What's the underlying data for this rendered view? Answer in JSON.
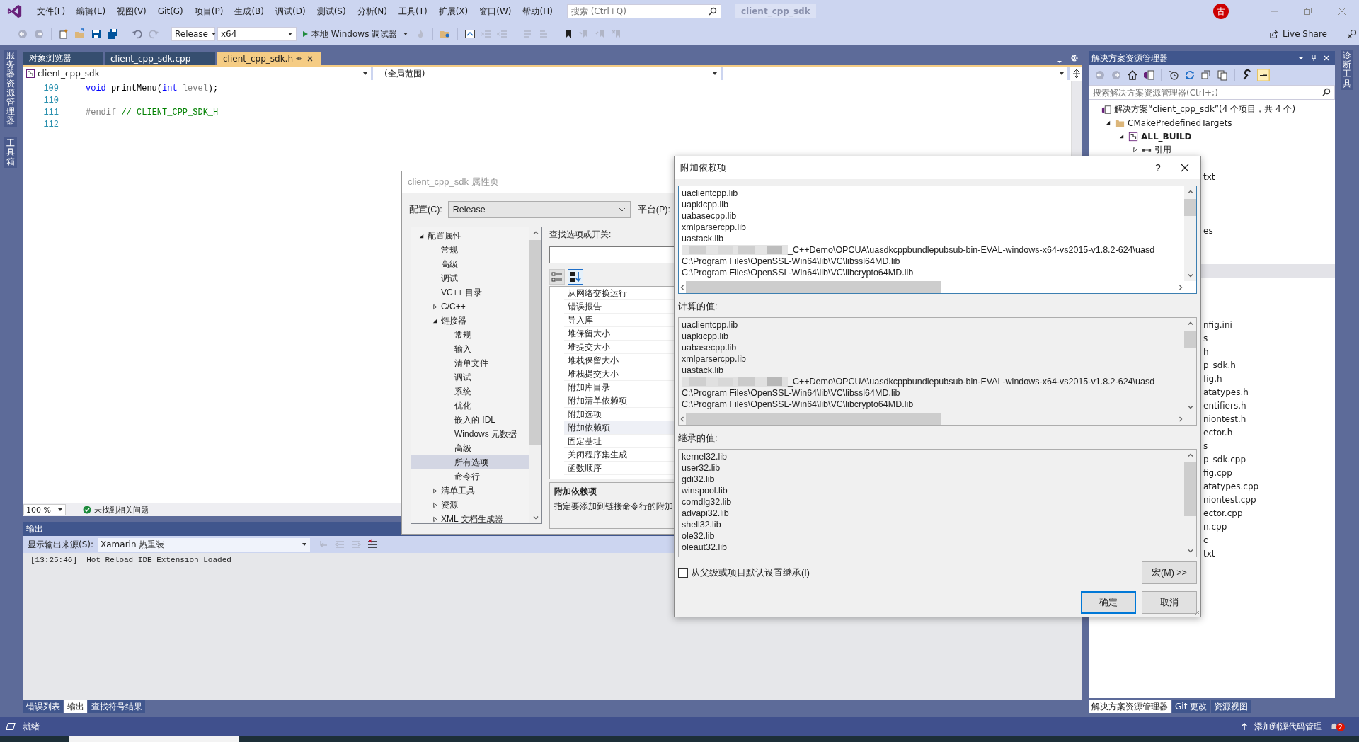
{
  "menu_bar": {
    "items": [
      "文件(F)",
      "编辑(E)",
      "视图(V)",
      "Git(G)",
      "项目(P)",
      "生成(B)",
      "调试(D)",
      "测试(S)",
      "分析(N)",
      "工具(T)",
      "扩展(X)",
      "窗口(W)",
      "帮助(H)"
    ],
    "search": {
      "placeholder": "搜索 (Ctrl+Q)"
    },
    "solution_name": "client_cpp_sdk",
    "avatar": "古"
  },
  "toolbar": {
    "configuration": "Release",
    "platform": "x64",
    "debugger": "本地 Windows 调试器",
    "live_share": "Live Share"
  },
  "left_rail": [
    "服务器资源管理器",
    "工具箱"
  ],
  "right_rail": [
    "诊断工具"
  ],
  "editor": {
    "tabs": [
      {
        "label": "对象浏览器",
        "selected": false
      },
      {
        "label": "client_cpp_sdk.cpp",
        "selected": false
      },
      {
        "label": "client_cpp_sdk.h",
        "selected": true
      }
    ],
    "project": "client_cpp_sdk",
    "scope": "(全局范围)",
    "lines": [
      {
        "number": "109",
        "tokens": [
          {
            "kind": "keyword",
            "text": "void"
          },
          {
            "kind": "plain",
            "text": " printMenu("
          },
          {
            "kind": "keyword",
            "text": "int"
          },
          {
            "kind": "param",
            "text": " level"
          },
          {
            "kind": "plain",
            "text": ");"
          }
        ]
      },
      {
        "number": "110"
      },
      {
        "number": "111",
        "tokens": [
          {
            "kind": "preprocessor",
            "text": "#endif"
          },
          {
            "kind": "comment",
            "text": " // CLIENT_CPP_SDK_H"
          }
        ]
      },
      {
        "number": "112"
      }
    ],
    "zoom": "100 %",
    "issues": "未找到相关问题"
  },
  "output": {
    "title": "输出",
    "source_label": "显示输出来源(S):",
    "source": "Xamarin 热重装",
    "lines": [
      "[13:25:46]  Hot Reload IDE Extension Loaded"
    ],
    "tabs": [
      {
        "label": "错误列表",
        "selected": false
      },
      {
        "label": "输出",
        "selected": true
      },
      {
        "label": "查找符号结果",
        "selected": false
      }
    ]
  },
  "solution_explorer": {
    "title": "解决方案资源管理器",
    "search": {
      "placeholder": "搜索解决方案资源管理器(Ctrl+;)"
    },
    "tree": [
      {
        "label": "解决方案“client_cpp_sdk”(4 个项目，共 4 个)",
        "kind": "solution",
        "children": [
          {
            "label": "CMakePredefinedTargets",
            "kind": "folder",
            "expanded": true,
            "children": [
              {
                "label": "ALL_BUILD",
                "kind": "project",
                "startup": true,
                "expanded": true,
                "children": [
                  {
                    "label": "引用",
                    "kind": "references",
                    "expanded": false
                  }
                ]
              }
            ]
          }
        ]
      }
    ],
    "covered_rows": [
      {
        "selected": false
      },
      {
        "text": "txt",
        "selected": false
      },
      {
        "selected": false
      },
      {
        "selected": false
      },
      {
        "selected": false
      },
      {
        "text": "es",
        "selected": false
      },
      {
        "selected": false
      },
      {
        "selected": false
      },
      {
        "selected": true
      },
      {
        "selected": false
      },
      {
        "selected": false
      },
      {
        "selected": false
      },
      {
        "text": "nfig.ini",
        "selected": false
      },
      {
        "text": "s",
        "selected": false
      },
      {
        "text": "h",
        "selected": false
      },
      {
        "text": "p_sdk.h",
        "selected": false
      },
      {
        "text": "fig.h",
        "selected": false
      },
      {
        "text": "atatypes.h",
        "selected": false
      },
      {
        "text": "entifiers.h",
        "selected": false
      },
      {
        "text": "niontest.h",
        "selected": false
      },
      {
        "text": "ector.h",
        "selected": false
      },
      {
        "text": "s",
        "selected": false
      },
      {
        "text": "p_sdk.cpp",
        "selected": false
      },
      {
        "text": "fig.cpp",
        "selected": false
      },
      {
        "text": "atatypes.cpp",
        "selected": false
      },
      {
        "text": "niontest.cpp",
        "selected": false
      },
      {
        "text": "ector.cpp",
        "selected": false
      },
      {
        "text": "n.cpp",
        "selected": false
      },
      {
        "text": "c",
        "selected": false
      },
      {
        "text": "txt",
        "selected": false
      }
    ],
    "tabs": [
      {
        "label": "解决方案资源管理器",
        "selected": true
      },
      {
        "label": "Git 更改",
        "selected": false
      },
      {
        "label": "资源视图",
        "selected": false
      }
    ]
  },
  "status_bar": {
    "text": "就绪",
    "source_control": "添加到源代码管理",
    "notifications": "2"
  },
  "property_pages": {
    "title": "client_cpp_sdk 属性页",
    "config_label": "配置(C):",
    "configuration": "Release",
    "platform_label": "平台(P):",
    "tree": [
      {
        "label": "配置属性",
        "expanded": true,
        "selected": false,
        "children": [
          {
            "label": "常规",
            "selected": false
          },
          {
            "label": "高级",
            "selected": false
          },
          {
            "label": "调试",
            "selected": false
          },
          {
            "label": "VC++ 目录",
            "selected": false
          },
          {
            "label": "C/C++",
            "expanded": false,
            "selected": false
          },
          {
            "label": "链接器",
            "expanded": true,
            "selected": false,
            "children": [
              {
                "label": "常规",
                "selected": false
              },
              {
                "label": "输入",
                "selected": false
              },
              {
                "label": "清单文件",
                "selected": false
              },
              {
                "label": "调试",
                "selected": false
              },
              {
                "label": "系统",
                "selected": false
              },
              {
                "label": "优化",
                "selected": false
              },
              {
                "label": "嵌入的 IDL",
                "selected": false
              },
              {
                "label": "Windows 元数据",
                "selected": false
              },
              {
                "label": "高级",
                "selected": false
              },
              {
                "label": "所有选项",
                "selected": true
              },
              {
                "label": "命令行",
                "selected": false
              }
            ]
          },
          {
            "label": "清单工具",
            "expanded": false,
            "selected": false
          },
          {
            "label": "资源",
            "expanded": false,
            "selected": false
          },
          {
            "label": "XML 文档生成器",
            "expanded": false,
            "selected": false
          }
        ]
      }
    ],
    "search_label": "查找选项或开关:",
    "properties": [
      {
        "name": "从网络交换运行",
        "selected": false
      },
      {
        "name": "错误报告",
        "selected": false
      },
      {
        "name": "导入库",
        "selected": false
      },
      {
        "name": "堆保留大小",
        "selected": false
      },
      {
        "name": "堆提交大小",
        "selected": false
      },
      {
        "name": "堆栈保留大小",
        "selected": false
      },
      {
        "name": "堆栈提交大小",
        "selected": false
      },
      {
        "name": "附加库目录",
        "selected": false
      },
      {
        "name": "附加清单依赖项",
        "selected": false
      },
      {
        "name": "附加选项",
        "selected": false
      },
      {
        "name": "附加依赖项",
        "selected": true
      },
      {
        "name": "固定基址",
        "selected": false
      },
      {
        "name": "关闭程序集生成",
        "selected": false
      },
      {
        "name": "函数顺序",
        "selected": false
      }
    ],
    "description": {
      "title": "附加依赖项",
      "text": "指定要添加到链接命令行的附加"
    }
  },
  "additional_dependencies": {
    "title": "附加依赖项",
    "help": "?",
    "entries": [
      {
        "text": "uaclientcpp.lib"
      },
      {
        "text": "uapkicpp.lib"
      },
      {
        "text": "uabasecpp.lib"
      },
      {
        "text": "xmlparsercpp.lib"
      },
      {
        "text": "uastack.lib"
      },
      {
        "text": "_C++Demo\\OPCUA\\uasdkcppbundlepubsub-bin-EVAL-windows-x64-vs2015-v1.8.2-624\\uasd",
        "redacted": true
      },
      {
        "text": "C:\\Program Files\\OpenSSL-Win64\\lib\\VC\\libssl64MD.lib"
      },
      {
        "text": "C:\\Program Files\\OpenSSL-Win64\\lib\\VC\\libcrypto64MD.lib"
      }
    ],
    "computed_label": "计算的值:",
    "computed": [
      {
        "text": "uaclientcpp.lib"
      },
      {
        "text": "uapkicpp.lib"
      },
      {
        "text": "uabasecpp.lib"
      },
      {
        "text": "xmlparsercpp.lib"
      },
      {
        "text": "uastack.lib"
      },
      {
        "text": "_C++Demo\\OPCUA\\uasdkcppbundlepubsub-bin-EVAL-windows-x64-vs2015-v1.8.2-624\\uasd",
        "redacted": true
      },
      {
        "text": "C:\\Program Files\\OpenSSL-Win64\\lib\\VC\\libssl64MD.lib"
      },
      {
        "text": "C:\\Program Files\\OpenSSL-Win64\\lib\\VC\\libcrypto64MD.lib"
      }
    ],
    "inherited_label": "继承的值:",
    "inherited": [
      "kernel32.lib",
      "user32.lib",
      "gdi32.lib",
      "winspool.lib",
      "comdlg32.lib",
      "advapi32.lib",
      "shell32.lib",
      "ole32.lib",
      "oleaut32.lib"
    ],
    "inherit_option": {
      "label": "从父级或项目默认设置继承(I)",
      "checked": false
    },
    "macros": "宏(M) >>",
    "buttons": [
      {
        "label": "确定",
        "default": true
      },
      {
        "label": "取消",
        "default": false
      }
    ]
  }
}
